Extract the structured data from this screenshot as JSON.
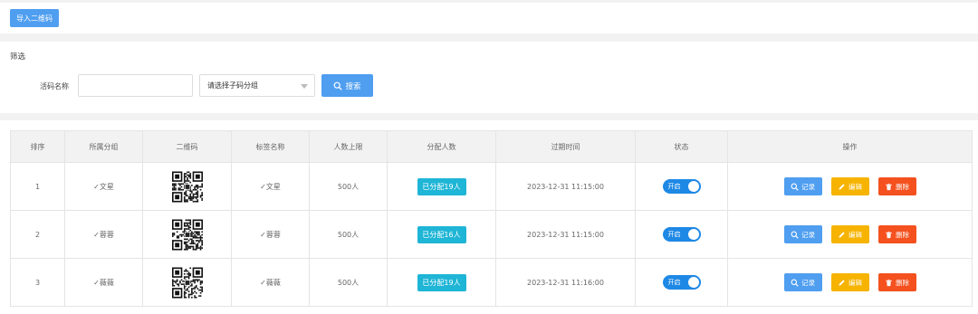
{
  "toolbar": {
    "import_label": "导入二维码"
  },
  "filter": {
    "title": "筛选",
    "name_label": "活码名称",
    "name_value": "",
    "group_placeholder": "请选择子码分组",
    "search_label": "搜索"
  },
  "table": {
    "headers": [
      "排序",
      "所属分组",
      "二维码",
      "标签名称",
      "人数上限",
      "分配人数",
      "过期时间",
      "状态",
      "操作"
    ],
    "rows": [
      {
        "order": "1",
        "group": "✓文星",
        "tag": "✓文星",
        "limit": "500人",
        "assigned": "已分配19人",
        "expire": "2023-12-31 11:15:00",
        "status": "开启"
      },
      {
        "order": "2",
        "group": "✓蓉蓉",
        "tag": "✓蓉蓉",
        "limit": "500人",
        "assigned": "已分配16人",
        "expire": "2023-12-31 11:15:00",
        "status": "开启"
      },
      {
        "order": "3",
        "group": "✓薇薇",
        "tag": "✓薇薇",
        "limit": "500人",
        "assigned": "已分配19人",
        "expire": "2023-12-31 11:16:00",
        "status": "开启"
      }
    ],
    "actions": {
      "record": "记录",
      "edit": "编辑",
      "delete": "删除"
    }
  },
  "colors": {
    "primary": "#4f9ef0",
    "info": "#1fb5d6",
    "warning": "#f6b300",
    "danger": "#f4511e",
    "toggle": "#1e88e5"
  }
}
